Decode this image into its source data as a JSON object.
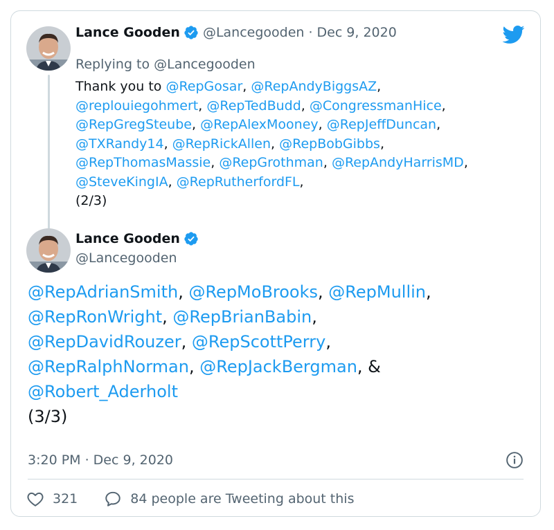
{
  "tweet1": {
    "display_name": "Lance Gooden",
    "handle": "@Lancegooden",
    "separator": "·",
    "date": "Dec 9, 2020",
    "replying_prefix": "Replying to ",
    "replying_to": "@Lancegooden",
    "lines": [
      [
        {
          "t": "Thank you to ",
          "m": false
        },
        {
          "t": "@RepGosar",
          "m": true
        },
        {
          "t": ", ",
          "m": false
        },
        {
          "t": "@RepAndyBiggsAZ",
          "m": true
        },
        {
          "t": ",",
          "m": false
        }
      ],
      [
        {
          "t": "@replouiegohmert",
          "m": true
        },
        {
          "t": ", ",
          "m": false
        },
        {
          "t": "@RepTedBudd",
          "m": true
        },
        {
          "t": ", ",
          "m": false
        },
        {
          "t": "@CongressmanHice",
          "m": true
        },
        {
          "t": ",",
          "m": false
        }
      ],
      [
        {
          "t": "@RepGregSteube",
          "m": true
        },
        {
          "t": ", ",
          "m": false
        },
        {
          "t": "@RepAlexMooney",
          "m": true
        },
        {
          "t": ", ",
          "m": false
        },
        {
          "t": "@RepJeffDuncan",
          "m": true
        },
        {
          "t": ",",
          "m": false
        }
      ],
      [
        {
          "t": "@TXRandy14",
          "m": true
        },
        {
          "t": ", ",
          "m": false
        },
        {
          "t": "@RepRickAllen",
          "m": true
        },
        {
          "t": ", ",
          "m": false
        },
        {
          "t": "@RepBobGibbs",
          "m": true
        },
        {
          "t": ",",
          "m": false
        }
      ],
      [
        {
          "t": "@RepThomasMassie",
          "m": true
        },
        {
          "t": ", ",
          "m": false
        },
        {
          "t": "@RepGrothman",
          "m": true
        },
        {
          "t": ", ",
          "m": false
        },
        {
          "t": "@RepAndyHarrisMD",
          "m": true
        },
        {
          "t": ",",
          "m": false
        }
      ],
      [
        {
          "t": "@SteveKingIA",
          "m": true
        },
        {
          "t": ", ",
          "m": false
        },
        {
          "t": "@RepRutherfordFL",
          "m": true
        },
        {
          "t": ",",
          "m": false
        }
      ],
      [
        {
          "t": " ",
          "m": false
        }
      ],
      [
        {
          "t": "(2/3)",
          "m": false
        }
      ]
    ]
  },
  "tweet2": {
    "display_name": "Lance Gooden",
    "handle": "@Lancegooden",
    "lines": [
      [
        {
          "t": "@RepAdrianSmith",
          "m": true
        },
        {
          "t": ", ",
          "m": false
        },
        {
          "t": "@RepMoBrooks",
          "m": true
        },
        {
          "t": ", ",
          "m": false
        },
        {
          "t": "@RepMullin",
          "m": true
        },
        {
          "t": ",",
          "m": false
        }
      ],
      [
        {
          "t": "@RepRonWright",
          "m": true
        },
        {
          "t": ", ",
          "m": false
        },
        {
          "t": "@RepBrianBabin",
          "m": true
        },
        {
          "t": ",",
          "m": false
        }
      ],
      [
        {
          "t": "@RepDavidRouzer",
          "m": true
        },
        {
          "t": ", ",
          "m": false
        },
        {
          "t": "@RepScottPerry",
          "m": true
        },
        {
          "t": ",",
          "m": false
        }
      ],
      [
        {
          "t": "@RepRalphNorman",
          "m": true
        },
        {
          "t": ", ",
          "m": false
        },
        {
          "t": "@RepJackBergman",
          "m": true
        },
        {
          "t": ", &",
          "m": false
        }
      ],
      [
        {
          "t": "@Robert_Aderholt",
          "m": true
        }
      ],
      [
        {
          "t": " ",
          "m": false
        }
      ],
      [
        {
          "t": "(3/3)",
          "m": false
        }
      ]
    ],
    "timestamp": "3:20 PM · Dec 9, 2020",
    "likes": "321",
    "replies_text": "84 people are Tweeting about this"
  },
  "icons": {
    "logo": "twitter-bird-icon",
    "verified": "verified-badge-icon",
    "info": "info-icon",
    "like": "heart-icon",
    "reply": "reply-bubble-icon"
  },
  "colors": {
    "accent": "#1d9bf0",
    "text": "#0f1419",
    "secondary": "#536471",
    "border": "#cfd9de"
  }
}
